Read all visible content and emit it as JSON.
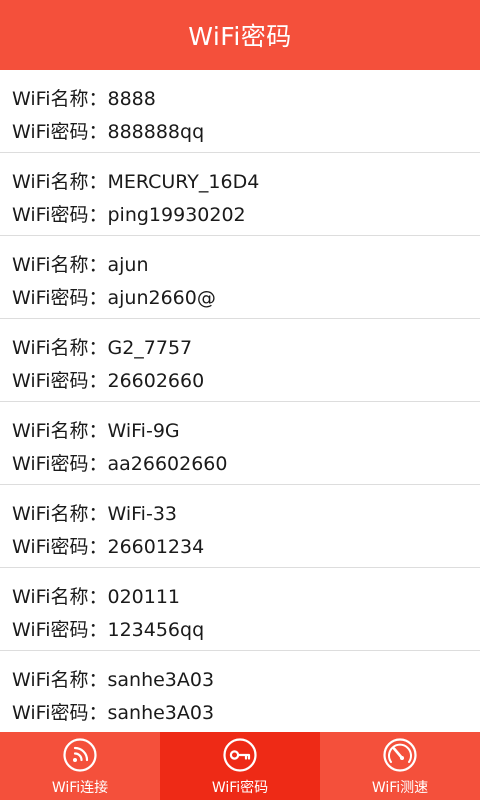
{
  "header": {
    "title": "WiFi密码"
  },
  "labels": {
    "name_prefix": "WiFi名称：",
    "password_prefix": "WiFi密码："
  },
  "wifi_list": [
    {
      "name": "8888",
      "password": "888888qq"
    },
    {
      "name": "MERCURY_16D4",
      "password": "ping19930202"
    },
    {
      "name": "ajun",
      "password": "ajun2660@"
    },
    {
      "name": "G2_7757",
      "password": "26602660"
    },
    {
      "name": "WiFi-9G",
      "password": "aa26602660"
    },
    {
      "name": "WiFi-33",
      "password": "26601234"
    },
    {
      "name": "020111",
      "password": "123456qq"
    },
    {
      "name": "sanhe3A03",
      "password": "sanhe3A03"
    }
  ],
  "tabs": [
    {
      "label": "WiFi连接",
      "icon": "wifi-signal-icon",
      "active": false
    },
    {
      "label": "WiFi密码",
      "icon": "key-icon",
      "active": true
    },
    {
      "label": "WiFi测速",
      "icon": "speedometer-icon",
      "active": false
    }
  ],
  "colors": {
    "primary": "#f4503b",
    "active_tab": "#ee2a16",
    "divider": "#dddddd"
  }
}
